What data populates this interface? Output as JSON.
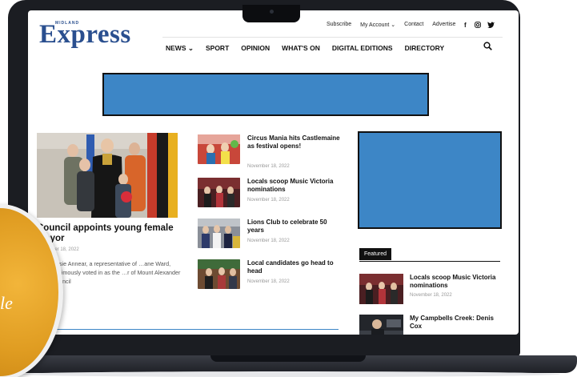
{
  "site": {
    "logo_text": "Express",
    "logo_small": "MIDLAND"
  },
  "top_links": [
    "Subscribe",
    "My Account ⌄",
    "Contact",
    "Advertise"
  ],
  "social_icons": [
    "facebook-icon",
    "instagram-icon",
    "twitter-icon"
  ],
  "nav": {
    "items": [
      "NEWS ⌄",
      "SPORT",
      "OPINION",
      "WHAT'S ON",
      "DIGITAL EDITIONS",
      "DIRECTORY"
    ]
  },
  "main_article": {
    "title": "Council appoints young female mayor",
    "date": "November 18, 2022",
    "excerpt": "…llor Rosie Annear, a representative of …ane Ward, was unanimously voted in as the …r of Mount Alexander Shire Council"
  },
  "list": [
    {
      "title": "Circus Mania hits Castlemaine as festival opens!",
      "date": "November 18, 2022"
    },
    {
      "title": "Locals scoop Music Victoria nominations",
      "date": "November 18, 2022"
    },
    {
      "title": "Lions Club to celebrate 50 years",
      "date": "November 18, 2022"
    },
    {
      "title": "Local candidates go head to head",
      "date": "November 18, 2022"
    }
  ],
  "featured": {
    "label": "Featured",
    "items": [
      {
        "title": "Locals scoop Music Victoria nominations",
        "date": "November 18, 2022"
      },
      {
        "title": "My Campbells Creek: Denis Cox",
        "date": ""
      }
    ]
  },
  "sticker": {
    "text": "le"
  },
  "colors": {
    "brand": "#2a4f8f",
    "ad_blue": "#3d86c6",
    "sticker": "#e09d22"
  }
}
